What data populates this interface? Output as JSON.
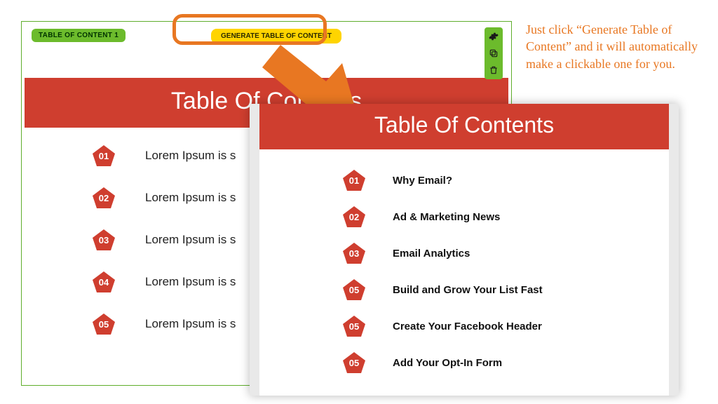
{
  "colors": {
    "brand_red": "#cf3e2f",
    "accent_orange": "#e87722",
    "tag_green": "#6cbb2c",
    "btn_yellow": "#ffd400"
  },
  "editor": {
    "tag_label": "TABLE OF CONTENT 1",
    "generate_label": "GENERATE TABLE OF CONTENT",
    "header_title": "Table Of Contents",
    "placeholder_text": "Lorem Ipsum is s",
    "tools": {
      "settings": "settings",
      "duplicate": "duplicate",
      "delete": "delete"
    },
    "items": [
      {
        "num": "01",
        "text": "Lorem Ipsum is s"
      },
      {
        "num": "02",
        "text": "Lorem Ipsum is s"
      },
      {
        "num": "03",
        "text": "Lorem Ipsum is s"
      },
      {
        "num": "04",
        "text": "Lorem Ipsum is s"
      },
      {
        "num": "05",
        "text": "Lorem Ipsum is s"
      }
    ]
  },
  "result": {
    "header_title": "Table Of Contents",
    "items": [
      {
        "num": "01",
        "text": "Why Email?"
      },
      {
        "num": "02",
        "text": "Ad & Marketing News"
      },
      {
        "num": "03",
        "text": "Email Analytics"
      },
      {
        "num": "05",
        "text": "Build and Grow Your List Fast"
      },
      {
        "num": "05",
        "text": "Create Your Facebook Header"
      },
      {
        "num": "05",
        "text": "Add Your Opt-In Form"
      }
    ]
  },
  "caption_text": "Just click “Generate Table of Content” and it will automatically make a clickable one for you."
}
